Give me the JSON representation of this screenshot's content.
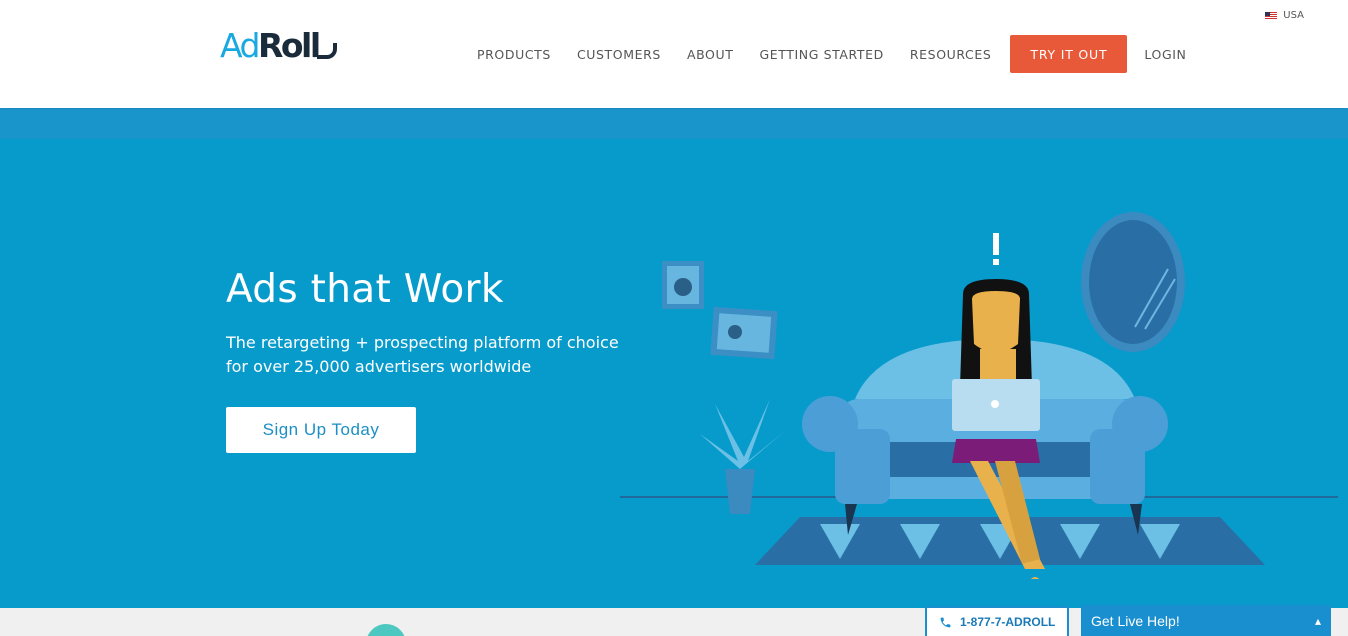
{
  "brand": {
    "logo_blue": "Ad",
    "logo_dark": "Roll",
    "accent": "#e8593a",
    "hero_bg": "#079bcc"
  },
  "locale": {
    "label": "USA"
  },
  "nav": {
    "items": [
      "PRODUCTS",
      "CUSTOMERS",
      "ABOUT",
      "GETTING STARTED",
      "RESOURCES"
    ],
    "cta": "TRY IT OUT",
    "login": "LOGIN"
  },
  "hero": {
    "title": "Ads that Work",
    "subtitle": "The retargeting + prospecting platform of choice for over 25,000 advertisers worldwide",
    "button": "Sign Up Today"
  },
  "contact": {
    "phone": "1-877-7-ADROLL",
    "live_help": "Get Live Help!",
    "phone_icon": "phone-icon",
    "chevron_icon": "chevron-up-icon"
  }
}
